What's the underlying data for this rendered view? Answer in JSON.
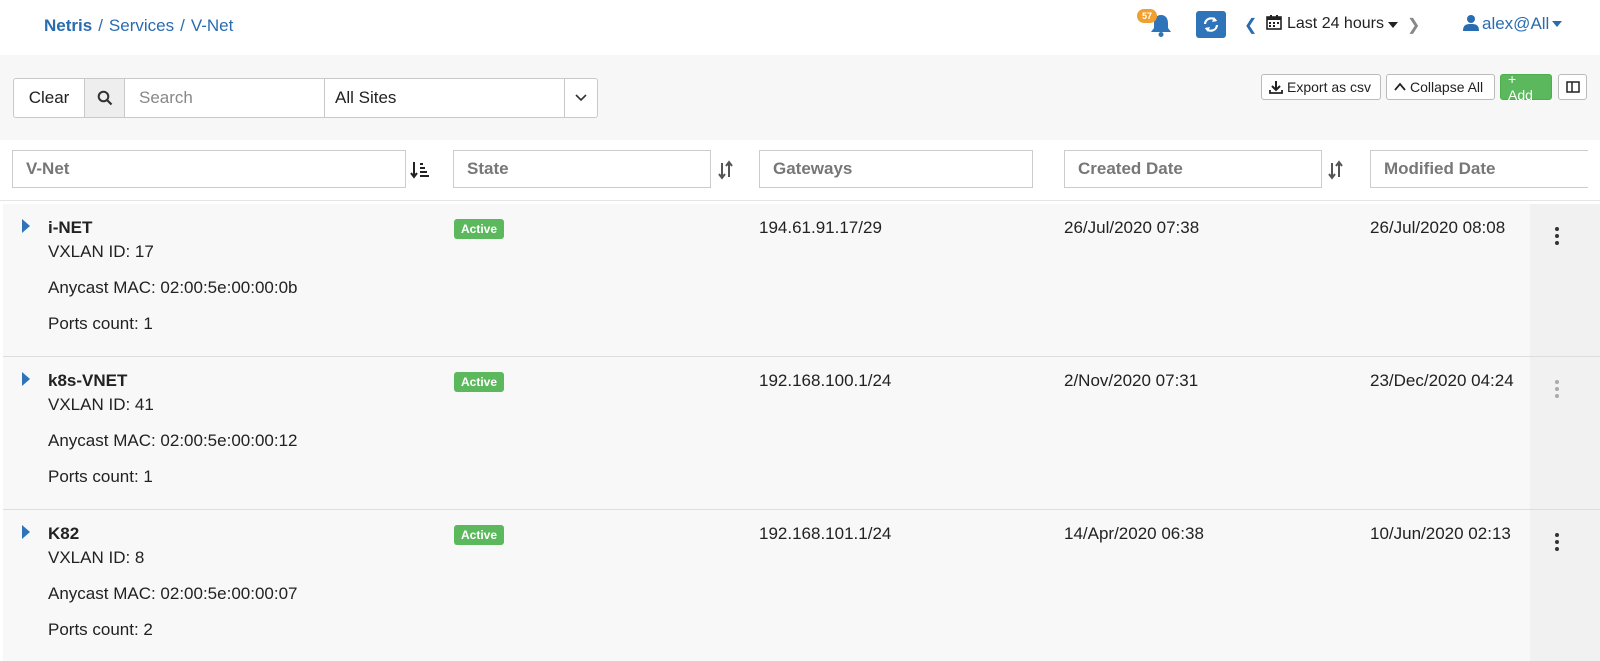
{
  "breadcrumb": {
    "root": "Netris",
    "items": [
      "Services",
      "V-Net"
    ]
  },
  "header": {
    "notification_count": "57",
    "time_range": "Last 24 hours",
    "user": "alex@All"
  },
  "filter": {
    "clear_label": "Clear",
    "search_placeholder": "Search",
    "site_selected": "All Sites"
  },
  "toolbar": {
    "export_label": "Export as csv",
    "collapse_label": "Collapse All",
    "add_label": "+ Add"
  },
  "columns": [
    "V-Net",
    "State",
    "Gateways",
    "Created Date",
    "Modified Date"
  ],
  "rows": [
    {
      "name": "i-NET",
      "vxlan": "VXLAN ID: 17",
      "mac": "Anycast MAC: 02:00:5e:00:00:0b",
      "ports": "Ports count: 1",
      "state": "Active",
      "gateway": "194.61.91.17/29",
      "created": "26/Jul/2020 07:38",
      "modified": "26/Jul/2020 08:08"
    },
    {
      "name": "k8s-VNET",
      "vxlan": "VXLAN ID: 41",
      "mac": "Anycast MAC: 02:00:5e:00:00:12",
      "ports": "Ports count: 1",
      "state": "Active",
      "gateway": "192.168.100.1/24",
      "created": "2/Nov/2020 07:31",
      "modified": "23/Dec/2020 04:24"
    },
    {
      "name": "K82",
      "vxlan": "VXLAN ID: 8",
      "mac": "Anycast MAC: 02:00:5e:00:00:07",
      "ports": "Ports count: 2",
      "state": "Active",
      "gateway": "192.168.101.1/24",
      "created": "14/Apr/2020 06:38",
      "modified": "10/Jun/2020 02:13"
    }
  ],
  "colors": {
    "accent": "#2a6cb0",
    "success": "#5cb85c",
    "badge": "#f0a030"
  }
}
